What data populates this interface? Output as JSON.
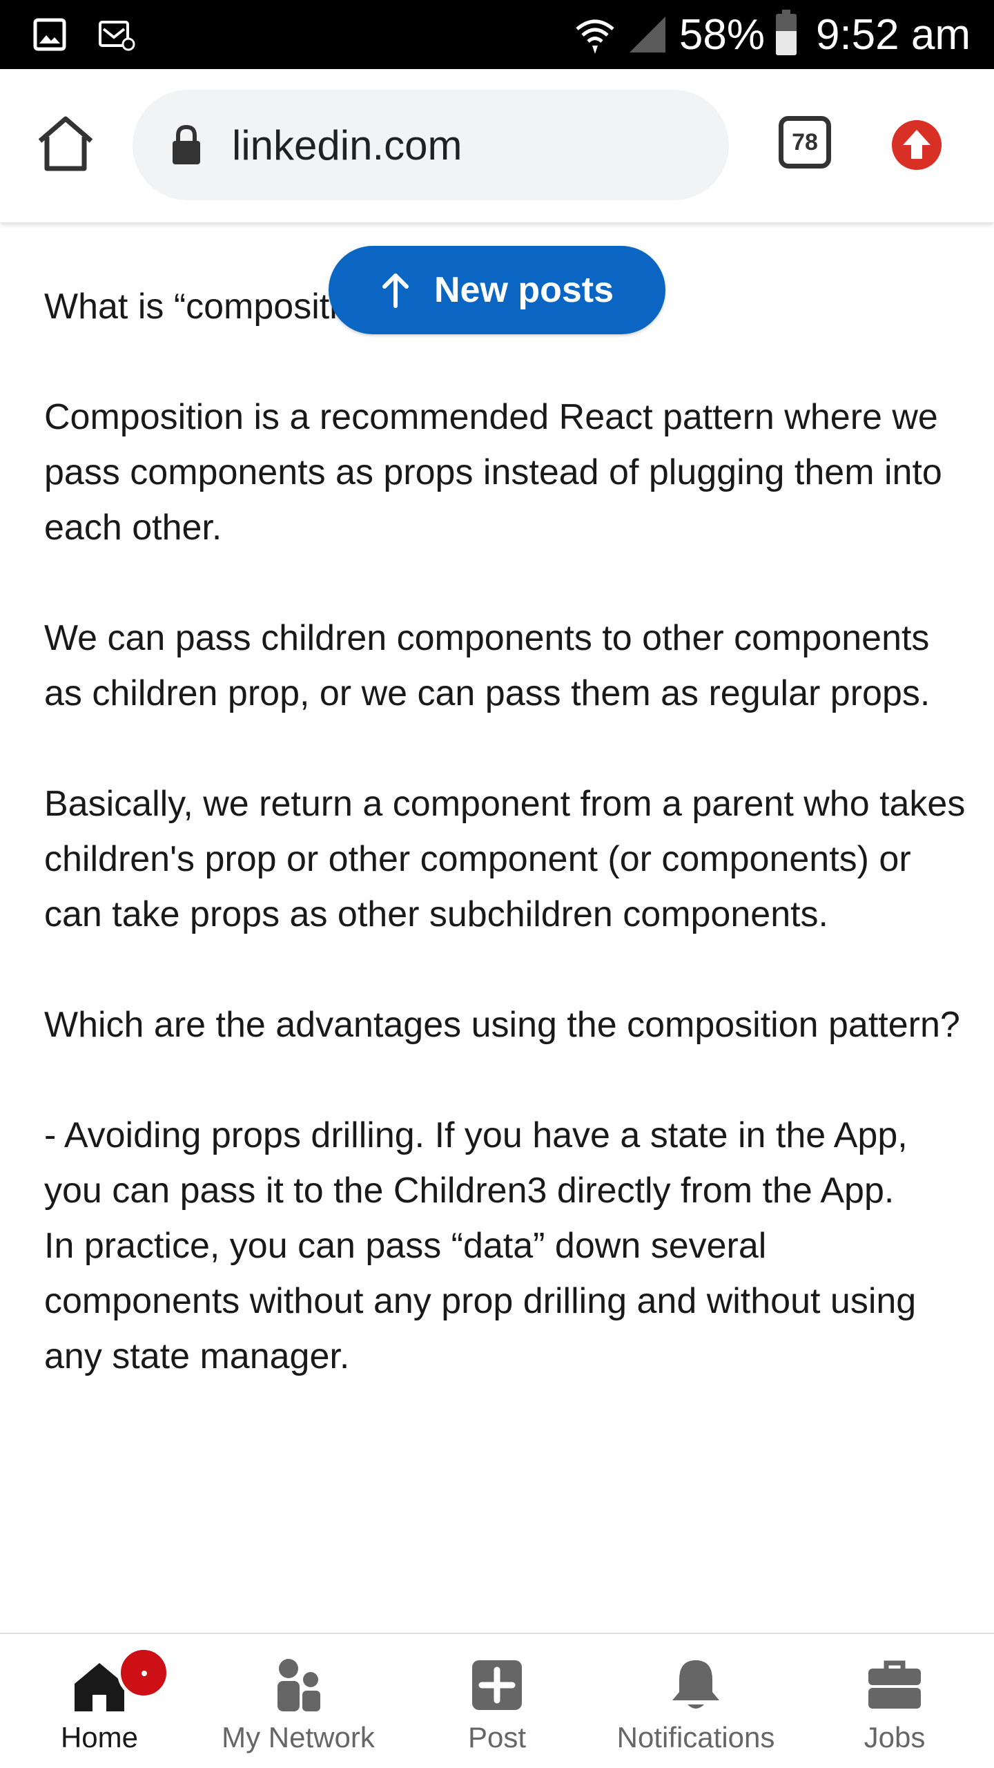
{
  "status_bar": {
    "battery_percent": "58%",
    "battery_level": 0.58,
    "time": "9:52 am",
    "icons": [
      "gallery-icon",
      "email-notification-icon",
      "wifi-icon",
      "signal-icon",
      "battery-icon"
    ]
  },
  "browser": {
    "url": "linkedin.com",
    "tab_count": "78",
    "icons": [
      "home-icon",
      "lock-icon",
      "tabs-icon",
      "update-icon"
    ]
  },
  "new_posts": {
    "label": "New posts",
    "color": "#0a66c2"
  },
  "post": {
    "paragraphs": [
      "What is “composition” first of all?",
      "Composition is a recommended React pattern where we pass components as props instead of plugging them into each other.",
      "We can pass children components to other components as children prop, or we can pass them as regular props.",
      "Basically, we return a component from a parent who takes children's prop or other component (or components) or can take props as other subchildren components.",
      "Which are the advantages using the composition pattern?",
      "- Avoiding props drilling. If you have a state in the App, you can pass it to the Children3 directly from the App.",
      "In practice, you can pass “data” down several components without any prop drilling and without using any state manager."
    ]
  },
  "bottom_nav": {
    "items": [
      {
        "label": "Home",
        "icon": "home-filled-icon",
        "active": true,
        "has_badge": true
      },
      {
        "label": "My Network",
        "icon": "people-icon",
        "active": false
      },
      {
        "label": "Post",
        "icon": "plus-square-icon",
        "active": false
      },
      {
        "label": "Notifications",
        "icon": "bell-icon",
        "active": false
      },
      {
        "label": "Jobs",
        "icon": "briefcase-icon",
        "active": false
      }
    ]
  },
  "colors": {
    "linkedin_blue": "#0a66c2",
    "badge_red": "#cc1016",
    "update_red": "#d93025"
  }
}
